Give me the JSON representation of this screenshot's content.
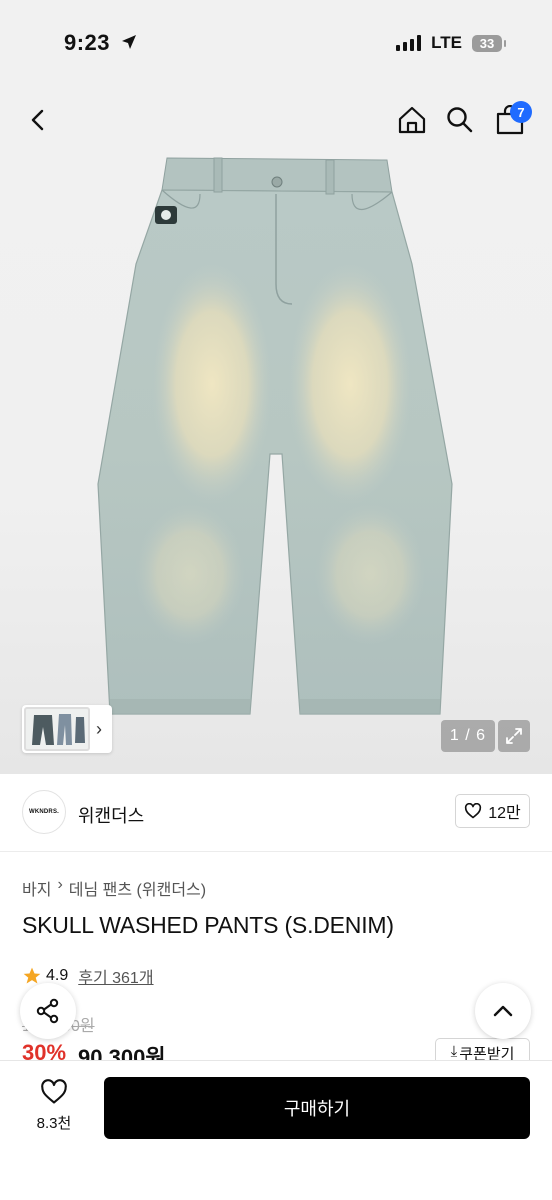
{
  "status": {
    "time": "9:23",
    "network": "LTE",
    "battery": "33"
  },
  "nav": {
    "cart_count": "7"
  },
  "gallery": {
    "counter": "1 / 6"
  },
  "brand": {
    "logo_text": "WKNDRS.",
    "name": "위캔더스",
    "likes": "12만"
  },
  "product": {
    "breadcrumb": [
      "바지",
      "데님 팬츠 (위캔더스)"
    ],
    "title": "SKULL WASHED PANTS (S.DENIM)",
    "rating": "4.9",
    "review_label": "후기 361개",
    "original_price": "129,000원",
    "discount": "30%",
    "price": "90,300원",
    "coupon_label": "쿠폰받기"
  },
  "bottom": {
    "wish_count": "8.3천",
    "buy_label": "구매하기"
  },
  "colors": {
    "accent": "#1f6bff",
    "discount": "#e0322a",
    "star": "#f5a623"
  }
}
